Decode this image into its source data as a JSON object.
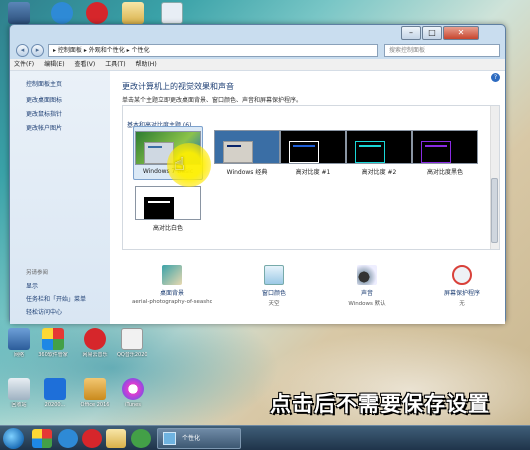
{
  "window": {
    "address_path": "▸ 控制面板 ▸ 外观和个性化 ▸ 个性化",
    "search_placeholder": "搜索控制面板",
    "min_label": "–",
    "max_label": "□",
    "close_label": "✕",
    "back_label": "◂",
    "forward_label": "▸"
  },
  "menu": [
    "文件(F)",
    "编辑(E)",
    "查看(V)",
    "工具(T)",
    "帮助(H)"
  ],
  "sidebar": {
    "items": [
      "控制面板主页",
      "更改桌面图标",
      "更改鼠标指针",
      "更改帐户图片"
    ],
    "see_also_label": "另请参阅",
    "see_also_items": [
      "显示",
      "任务栏和「开始」菜单",
      "轻松访问中心"
    ]
  },
  "main": {
    "title": "更改计算机上的视觉效果和声音",
    "subtitle": "单击某个主题立即更改桌面背景、窗口颜色、声音和屏幕保护程序。",
    "help_label": "?",
    "group_heading": "基本和高对比度主题 (6)",
    "themes": [
      {
        "name": "Windows 7 Basic",
        "bg": "#3d8f3a",
        "mini_bg": "#cfd8e2"
      },
      {
        "name": "Windows 经典",
        "bg": "#3a6ea5",
        "mini_bg": "#d4d0c8"
      },
      {
        "name": "高对比度 #1",
        "bg": "#000000",
        "mini_bg": "#000000"
      },
      {
        "name": "高对比度 #2",
        "bg": "#000000",
        "mini_bg": "#000000"
      },
      {
        "name": "高对比度黑色",
        "bg": "#000000",
        "mini_bg": "#000000"
      },
      {
        "name": "高对比白色",
        "bg": "#ffffff",
        "mini_bg": "#ffffff"
      }
    ],
    "bottom": [
      {
        "label": "桌面背景",
        "value": "aerial-photography-of-seashore...",
        "icon": "desktop-background-icon"
      },
      {
        "label": "窗口颜色",
        "value": "天空",
        "icon": "window-color-icon"
      },
      {
        "label": "声音",
        "value": "Windows 默认",
        "icon": "sound-icon"
      },
      {
        "label": "屏幕保护程序",
        "value": "无",
        "icon": "screensaver-icon"
      }
    ]
  },
  "desktop": {
    "icons_top": [
      "computer-icon",
      "ie-icon",
      "netease-music-icon",
      "folder-icon",
      "document-icon"
    ],
    "icons_mid": [
      {
        "label": "网络"
      },
      {
        "label": "360软件管家"
      },
      {
        "label": "网易云音乐"
      },
      {
        "label": "QQ音乐20200..."
      }
    ],
    "icons_bottom": [
      {
        "label": "回收站"
      },
      {
        "label": "20200..."
      },
      {
        "label": "Office 2016"
      },
      {
        "label": "iTunes"
      }
    ]
  },
  "caption": "点击后不需要保存设置",
  "taskbar": {
    "task_label": "个性化"
  }
}
